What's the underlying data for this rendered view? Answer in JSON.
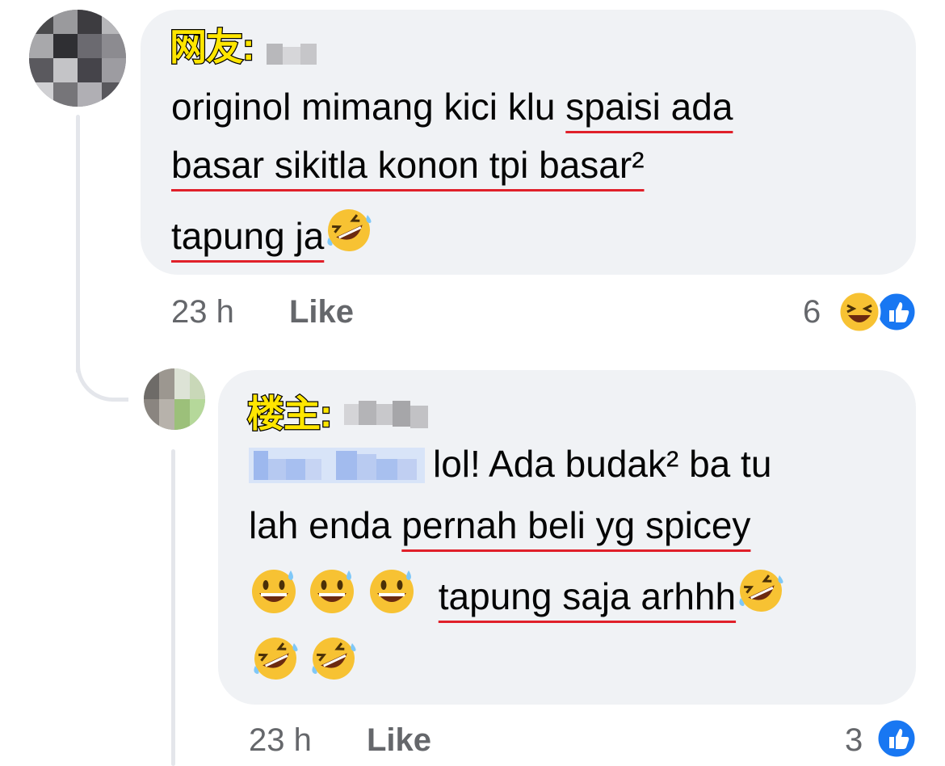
{
  "comment": {
    "tag": "网友:",
    "lines": [
      {
        "plain": "originol mimang kici klu ",
        "underlined": "spaisi ada"
      },
      {
        "plain": "",
        "underlined": "basar sikitla konon tpi basar²"
      },
      {
        "plain": "",
        "underlined": "tapung ja",
        "emoji": "rofl-emoji"
      }
    ],
    "time": "23 h",
    "like_label": "Like",
    "reaction_count": "6",
    "reactions": [
      "haha-reaction-icon",
      "like-reaction-icon"
    ]
  },
  "reply": {
    "tag": "楼主:",
    "lines": [
      {
        "plain": "lol! Ada budak² ba tu"
      },
      {
        "plain": "lah enda ",
        "underlined": "pernah beli yg spicey"
      },
      {
        "emoji_before": [
          "grinning-sweat-emoji",
          "grinning-sweat-emoji",
          "grinning-sweat-emoji"
        ],
        "underlined": "tapung saja arhhh",
        "emoji": "rofl-emoji"
      },
      {
        "emoji_before": [
          "rofl-emoji",
          "rofl-emoji"
        ]
      }
    ],
    "time": "23 h",
    "like_label": "Like",
    "reaction_count": "3",
    "reactions": [
      "like-reaction-icon"
    ]
  },
  "colors": {
    "bubble": "#f0f2f5",
    "underline": "#e0202a",
    "tag_fill": "#ffe600",
    "like_blue": "#1877f2",
    "meta_text": "#65676b"
  }
}
